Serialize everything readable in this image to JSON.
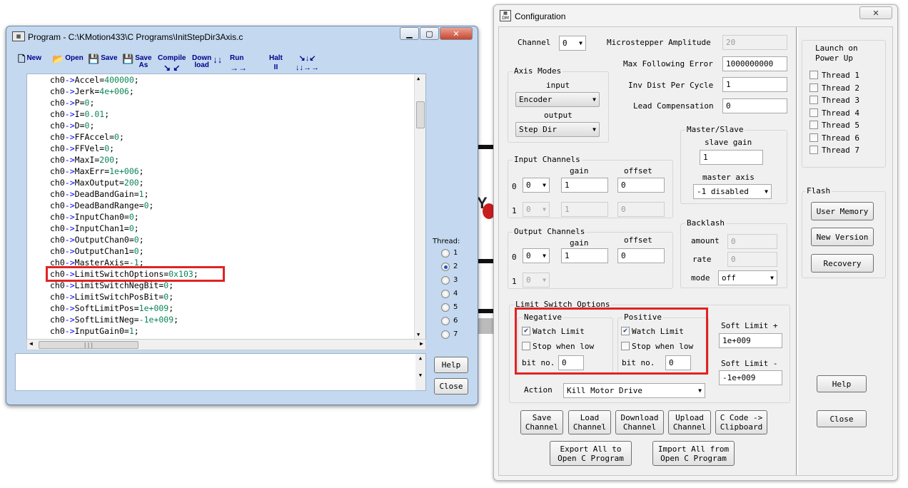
{
  "program_window": {
    "title": "Program - C:\\KMotion433\\C Programs\\InitStepDir3Axis.c",
    "toolbar": {
      "new": "New",
      "open": "Open",
      "save": "Save",
      "save_as_1": "Save",
      "save_as_2": "As",
      "compile": "Compile",
      "download_1": "Down",
      "download_2": "load",
      "run": "Run",
      "halt": "Halt"
    },
    "code_lines": [
      {
        "obj": "ch0",
        "field": "Accel",
        "value": "400000"
      },
      {
        "obj": "ch0",
        "field": "Jerk",
        "value": "4e+006"
      },
      {
        "obj": "ch0",
        "field": "P",
        "value": "0"
      },
      {
        "obj": "ch0",
        "field": "I",
        "value": "0.01"
      },
      {
        "obj": "ch0",
        "field": "D",
        "value": "0"
      },
      {
        "obj": "ch0",
        "field": "FFAccel",
        "value": "0"
      },
      {
        "obj": "ch0",
        "field": "FFVel",
        "value": "0"
      },
      {
        "obj": "ch0",
        "field": "MaxI",
        "value": "200"
      },
      {
        "obj": "ch0",
        "field": "MaxErr",
        "value": "1e+006"
      },
      {
        "obj": "ch0",
        "field": "MaxOutput",
        "value": "200"
      },
      {
        "obj": "ch0",
        "field": "DeadBandGain",
        "value": "1"
      },
      {
        "obj": "ch0",
        "field": "DeadBandRange",
        "value": "0"
      },
      {
        "obj": "ch0",
        "field": "InputChan0",
        "value": "0"
      },
      {
        "obj": "ch0",
        "field": "InputChan1",
        "value": "0"
      },
      {
        "obj": "ch0",
        "field": "OutputChan0",
        "value": "0"
      },
      {
        "obj": "ch0",
        "field": "OutputChan1",
        "value": "0"
      },
      {
        "obj": "ch0",
        "field": "MasterAxis",
        "value": "-1"
      },
      {
        "obj": "ch0",
        "field": "LimitSwitchOptions",
        "value": "0x103"
      },
      {
        "obj": "ch0",
        "field": "LimitSwitchNegBit",
        "value": "0"
      },
      {
        "obj": "ch0",
        "field": "LimitSwitchPosBit",
        "value": "0"
      },
      {
        "obj": "ch0",
        "field": "SoftLimitPos",
        "value": "1e+009"
      },
      {
        "obj": "ch0",
        "field": "SoftLimitNeg",
        "value": "-1e+009"
      },
      {
        "obj": "ch0",
        "field": "InputGain0",
        "value": "1"
      }
    ],
    "thread_label": "Thread:",
    "threads": [
      "1",
      "2",
      "3",
      "4",
      "5",
      "6",
      "7"
    ],
    "selected_thread": "2",
    "help_button": "Help",
    "close_button": "Close"
  },
  "config_window": {
    "title": "Configuration",
    "channel_label": "Channel",
    "channel_value": "0",
    "microstepper_amplitude_label": "Microstepper Amplitude",
    "microstepper_amplitude_value": "20",
    "max_following_error_label": "Max Following Error",
    "max_following_error_value": "1000000000",
    "inv_dist_per_cycle_label": "Inv Dist Per Cycle",
    "inv_dist_per_cycle_value": "1",
    "lead_compensation_label": "Lead Compensation",
    "lead_compensation_value": "0",
    "axis_modes": {
      "title": "Axis Modes",
      "input_label": "input",
      "input_value": "Encoder",
      "output_label": "output",
      "output_value": "Step Dir"
    },
    "input_channels": {
      "title": "Input Channels",
      "gain_label": "gain",
      "offset_label": "offset",
      "row0_label": "0",
      "row0_channel": "0",
      "row0_gain": "1",
      "row0_offset": "0",
      "row1_label": "1",
      "row1_channel": "0",
      "row1_gain": "1",
      "row1_offset": "0"
    },
    "output_channels": {
      "title": "Output Channels",
      "gain_label": "gain",
      "offset_label": "offset",
      "row0_label": "0",
      "row0_channel": "0",
      "row0_gain": "1",
      "row0_offset": "0",
      "row1_label": "1",
      "row1_channel": "0"
    },
    "master_slave": {
      "title": "Master/Slave",
      "slave_gain_label": "slave gain",
      "slave_gain_value": "1",
      "master_axis_label": "master axis",
      "master_axis_value": "-1 disabled"
    },
    "backlash": {
      "title": "Backlash",
      "amount_label": "amount",
      "amount_value": "0",
      "rate_label": "rate",
      "rate_value": "0",
      "mode_label": "mode",
      "mode_value": "off"
    },
    "limit_switch": {
      "title": "Limit Switch Options",
      "negative": {
        "title": "Negative",
        "watch_limit_label": "Watch Limit",
        "watch_limit_checked": true,
        "stop_when_low_label": "Stop when low",
        "stop_when_low_checked": false,
        "bit_no_label": "bit no.",
        "bit_no_value": "0"
      },
      "positive": {
        "title": "Positive",
        "watch_limit_label": "Watch Limit",
        "watch_limit_checked": true,
        "stop_when_low_label": "Stop when low",
        "stop_when_low_checked": false,
        "bit_no_label": "bit no.",
        "bit_no_value": "0"
      },
      "soft_limit_pos_label": "Soft Limit +",
      "soft_limit_pos_value": "1e+009",
      "soft_limit_neg_label": "Soft Limit -",
      "soft_limit_neg_value": "-1e+009",
      "action_label": "Action",
      "action_value": "Kill Motor Drive"
    },
    "buttons": {
      "save_channel_1": "Save",
      "save_channel_2": "Channel",
      "load_channel_1": "Load",
      "load_channel_2": "Channel",
      "download_channel_1": "Download",
      "download_channel_2": "Channel",
      "upload_channel_1": "Upload",
      "upload_channel_2": "Channel",
      "c_code_1": "C Code ->",
      "c_code_2": "Clipboard",
      "export_1": "Export All to",
      "export_2": "Open C Program",
      "import_1": "Import All from",
      "import_2": "Open C Program"
    },
    "launch": {
      "title_1": "Launch on",
      "title_2": "Power Up",
      "threads": [
        "Thread 1",
        "Thread 2",
        "Thread 3",
        "Thread 4",
        "Thread 5",
        "Thread 6",
        "Thread 7"
      ]
    },
    "flash": {
      "title": "Flash",
      "user_memory": "User Memory",
      "new_version": "New Version",
      "recovery": "Recovery"
    },
    "help_button": "Help",
    "close_button": "Close"
  },
  "colors": {
    "highlight_box": "#e02323",
    "code_arrow": "#0000ff",
    "code_number": "#098658",
    "toolbar_text": "#00008b"
  }
}
